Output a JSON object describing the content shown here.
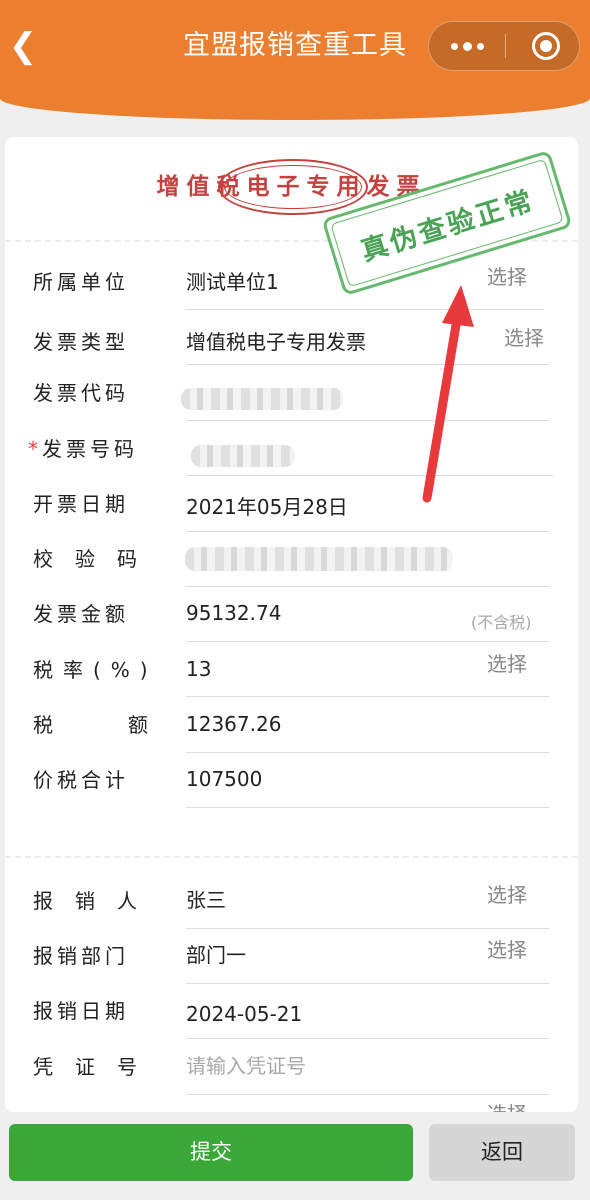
{
  "header": {
    "title": "宜盟报销查重工具"
  },
  "invoice": {
    "title": "增值税电子专用发票",
    "verify_stamp": "真伪查验正常",
    "fields": [
      {
        "label": "所属单位",
        "value": "测试单位1",
        "action": "选择"
      },
      {
        "label": "发票类型",
        "value": "增值税电子专用发票",
        "action": "选择"
      },
      {
        "label": "发票代码",
        "value": ""
      },
      {
        "label": "发票号码",
        "value": "",
        "required_mark": "*"
      },
      {
        "label": "开票日期",
        "value": "2021年05月28日"
      },
      {
        "label": "校验码",
        "value": ""
      },
      {
        "label": "发票金额",
        "value": "95132.74",
        "hint": "(不含税)"
      },
      {
        "label": "税率(%)",
        "value": "13",
        "action": "选择"
      },
      {
        "label": "税额",
        "value": "12367.26"
      },
      {
        "label": "价税合计",
        "value": "107500"
      }
    ]
  },
  "reimburse": {
    "fields": [
      {
        "label": "报销人",
        "value": "张三",
        "action": "选择"
      },
      {
        "label": "报销部门",
        "value": "部门一",
        "action": "选择"
      },
      {
        "label": "报销日期",
        "value": "2024-05-21"
      },
      {
        "label": "凭证号",
        "placeholder": "请输入凭证号"
      },
      {
        "action": "选择"
      }
    ]
  },
  "footer": {
    "submit_label": "提交",
    "back_label": "返回"
  },
  "colors": {
    "header_bg": "#ec7f2f",
    "invoice_red": "#c2423f",
    "stamp_green": "#4aa355",
    "arrow_red": "#e8393c",
    "submit_green": "#3ba739"
  }
}
